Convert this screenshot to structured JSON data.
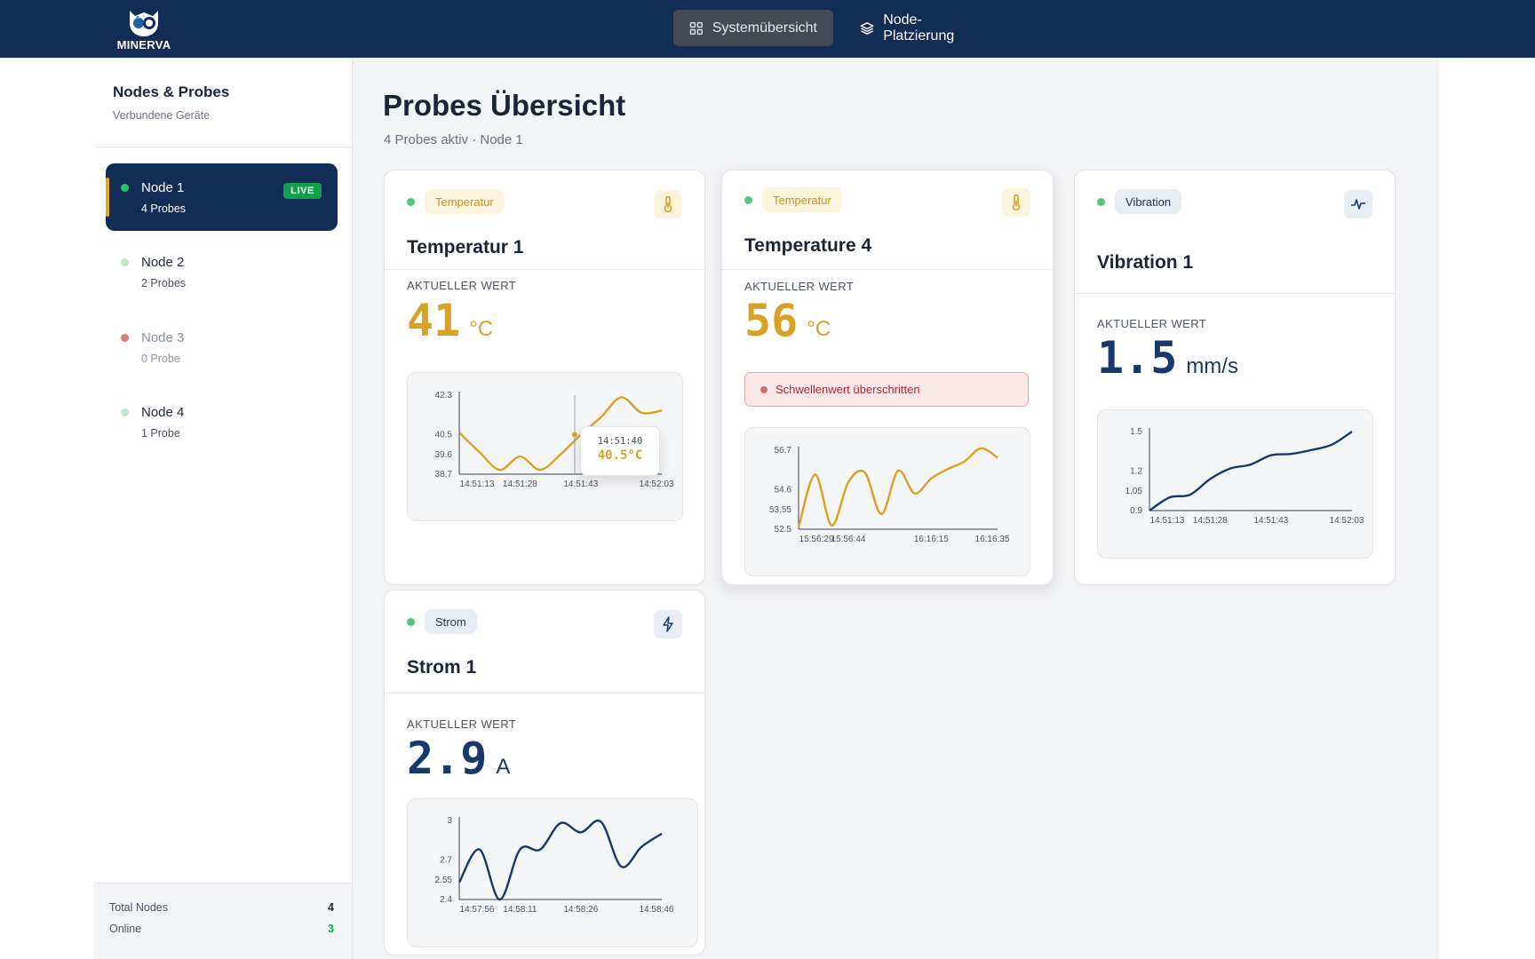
{
  "app": {
    "logo_text": "MINERVA"
  },
  "nav": [
    {
      "label": "Systemübersicht",
      "icon": "grid-icon",
      "active": true
    },
    {
      "label": "Node-Platzierung",
      "icon": "layers-icon",
      "active": false
    }
  ],
  "sidebar": {
    "title": "Nodes & Probes",
    "subtitle": "Verbundene Geräte",
    "nodes": [
      {
        "name": "Node 1",
        "count": "4 Probes",
        "status_color": "#22c55e",
        "badge": "LIVE",
        "active": true
      },
      {
        "name": "Node 2",
        "count": "2 Probes",
        "status_color": "#bfe8cc"
      },
      {
        "name": "Node 3",
        "count": "0 Probe",
        "status_color": "#d9827c"
      },
      {
        "name": "Node 4",
        "count": "1 Probe",
        "status_color": "#bfe8cc"
      }
    ],
    "footer": {
      "total_label": "Total Nodes",
      "total_value": "4",
      "online_label": "Online",
      "online_value": "3"
    }
  },
  "main": {
    "title": "Probes Übersicht",
    "subtitle": "4 Probes aktiv  · Node 1"
  },
  "probes": [
    {
      "badge": "Temperatur",
      "name": "Temperatur 1",
      "value_label": "AKTUELLER WERT",
      "value": "41",
      "unit": "°C",
      "icon": "thermometer-icon",
      "tooltip": {
        "time": "14:51:40",
        "value": "40.5°C"
      }
    },
    {
      "badge": "Temperatur",
      "name": "Temperature 4",
      "value_label": "AKTUELLER WERT",
      "value": "56",
      "unit": "°C",
      "icon": "thermometer-icon",
      "alert": "Schwellenwert überschritten"
    },
    {
      "badge": "Vibration",
      "name": "Vibration 1",
      "value_label": "AKTUELLER WERT",
      "value": "1.5",
      "unit": "mm/s",
      "icon": "activity-icon"
    },
    {
      "badge": "Strom",
      "name": "Strom 1",
      "value_label": "AKTUELLER WERT",
      "value": "2.9",
      "unit": "A",
      "icon": "lightning-icon"
    }
  ],
  "colors": {
    "amber": "#d9a224",
    "navy": "#17386b",
    "topbar": "#112c55"
  },
  "chart_data": [
    {
      "type": "line",
      "series_color": "#d9a224",
      "x": [
        "14:51:13",
        "14:51:18",
        "14:51:23",
        "14:51:28",
        "14:51:33",
        "14:51:38",
        "14:51:43",
        "14:51:48",
        "14:51:53",
        "14:51:58",
        "14:52:03"
      ],
      "values": [
        40.6,
        39.7,
        38.9,
        39.5,
        38.9,
        39.6,
        40.5,
        41.3,
        42.2,
        41.5,
        41.6
      ],
      "yticks": [
        42.3,
        40.5,
        39.6,
        38.7
      ],
      "xticks": [
        "14:51:13",
        "14:51:28",
        "14:51:43",
        "14:52:03"
      ],
      "ylim": [
        38.7,
        42.3
      ]
    },
    {
      "type": "line",
      "series_color": "#d9a224",
      "x": [
        "15:56:29",
        "15:56:34",
        "15:56:39",
        "15:56:44",
        "15:56:49",
        "15:56:54",
        "16:16:05",
        "16:16:10",
        "16:16:15",
        "16:16:20",
        "16:16:25",
        "16:16:30",
        "16:16:35"
      ],
      "values": [
        52.6,
        55.4,
        52.7,
        55.0,
        55.5,
        53.3,
        55.6,
        54.4,
        55.2,
        55.7,
        56.1,
        56.8,
        56.3
      ],
      "yticks": [
        56.7,
        54.6,
        53.55,
        52.5
      ],
      "xticks": [
        "15:56:29",
        "15:56:44",
        "16:16:15",
        "16:16:35"
      ],
      "ylim": [
        52.5,
        56.7
      ]
    },
    {
      "type": "line",
      "series_color": "#17386b",
      "x": [
        "14:51:13",
        "14:51:18",
        "14:51:23",
        "14:51:28",
        "14:51:33",
        "14:51:38",
        "14:51:43",
        "14:51:48",
        "14:51:53",
        "14:51:58",
        "14:52:03"
      ],
      "values": [
        0.9,
        1.0,
        1.02,
        1.14,
        1.22,
        1.25,
        1.32,
        1.33,
        1.36,
        1.4,
        1.5
      ],
      "yticks": [
        1.5,
        1.2,
        1.05,
        0.9
      ],
      "xticks": [
        "14:51:13",
        "14:51:28",
        "14:51:43",
        "14:52:03"
      ],
      "ylim": [
        0.9,
        1.5
      ]
    },
    {
      "type": "line",
      "series_color": "#17386b",
      "x": [
        "14:57:56",
        "14:58:01",
        "14:58:06",
        "14:58:11",
        "14:58:16",
        "14:58:21",
        "14:58:26",
        "14:58:31",
        "14:58:36",
        "14:58:41",
        "14:58:46"
      ],
      "values": [
        2.53,
        2.78,
        2.4,
        2.78,
        2.78,
        2.98,
        2.91,
        2.99,
        2.65,
        2.8,
        2.9
      ],
      "yticks": [
        3,
        2.7,
        2.55,
        2.4
      ],
      "xticks": [
        "14:57:56",
        "14:58:11",
        "14:58:26",
        "14:58:46"
      ],
      "ylim": [
        2.4,
        3.0
      ]
    }
  ]
}
